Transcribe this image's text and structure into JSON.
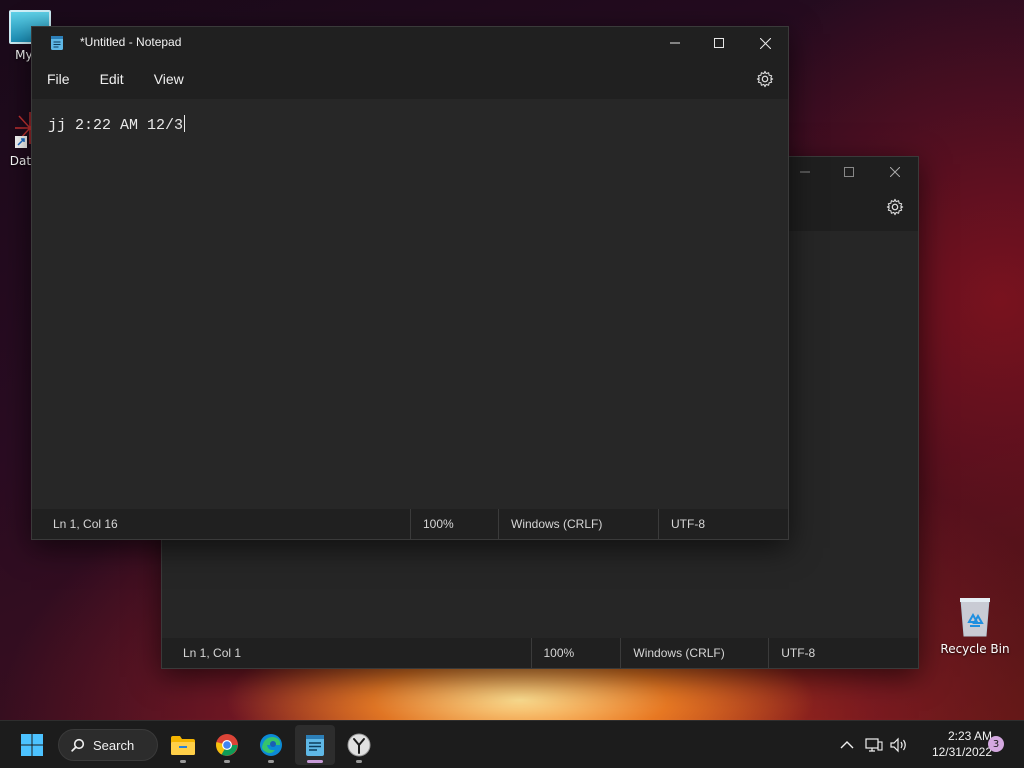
{
  "desktop": {
    "icons": [
      {
        "label": "My C",
        "icon": "computer-icon"
      },
      {
        "label": "DataW",
        "icon": "shortcut-app-icon"
      },
      {
        "label": "Recycle Bin",
        "icon": "recycle-bin-icon"
      }
    ]
  },
  "notepad_front": {
    "title": "*Untitled - Notepad",
    "menu": [
      "File",
      "Edit",
      "View"
    ],
    "content": "jj 2:22 AM 12/3",
    "status": {
      "position": "Ln 1, Col 16",
      "zoom": "100%",
      "line_ending": "Windows (CRLF)",
      "encoding": "UTF-8"
    }
  },
  "notepad_back": {
    "status": {
      "position": "Ln 1, Col 1",
      "zoom": "100%",
      "line_ending": "Windows (CRLF)",
      "encoding": "UTF-8"
    }
  },
  "taskbar": {
    "search_label": "Search",
    "apps": [
      "start-icon",
      "file-explorer-icon",
      "chrome-icon",
      "edge-icon",
      "notepad-icon",
      "clock-app-icon"
    ],
    "tray_icons": [
      "chevron-up-icon",
      "network-icon",
      "volume-icon"
    ],
    "clock": {
      "time": "2:23 AM",
      "date": "12/31/2022"
    },
    "notification_count": "3"
  },
  "colors": {
    "window_bg": "#202020",
    "editor_bg": "#272727",
    "taskbar_bg": "#1c1c1c",
    "accent_indicator": "#c79bd8"
  }
}
